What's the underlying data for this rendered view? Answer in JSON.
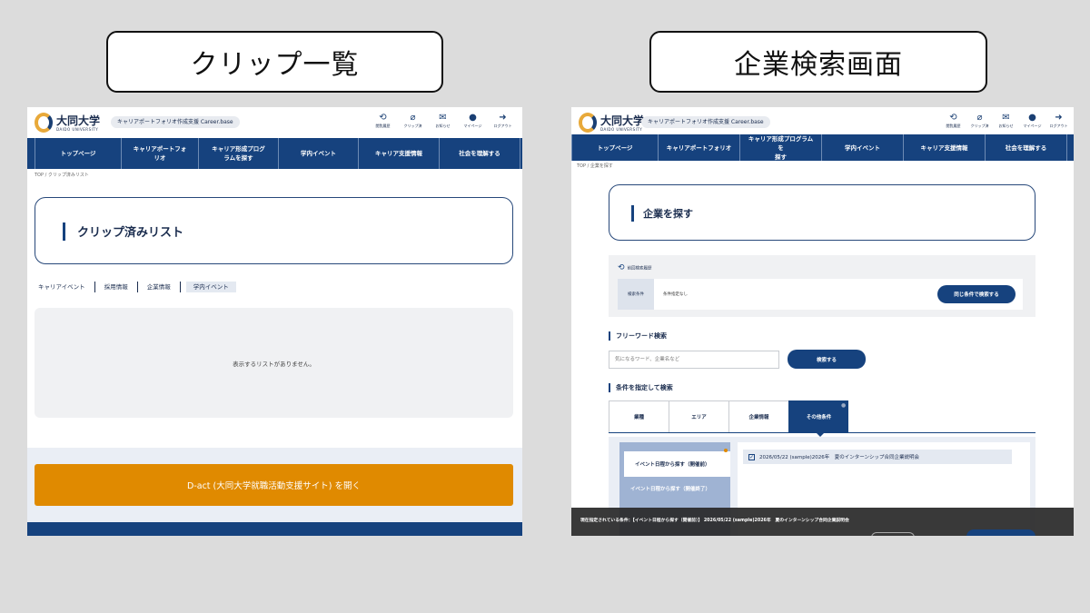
{
  "captions": {
    "left": "クリップ一覧",
    "right": "企業検索画面"
  },
  "header": {
    "logo_name": "大同大学",
    "logo_sub": "DAIDO UNIVERSITY",
    "service": "キャリアポートフォリオ作成支援 Career.base",
    "icons": [
      {
        "glyph": "⟲",
        "label": "閲覧履歴",
        "icon": "history-icon"
      },
      {
        "glyph": "⌀",
        "label": "クリップ済",
        "icon": "paperclip-icon"
      },
      {
        "glyph": "✉",
        "label": "お知らせ",
        "icon": "notice-icon"
      },
      {
        "glyph": "●",
        "label": "マイページ",
        "icon": "user-icon"
      },
      {
        "glyph": "➜",
        "label": "ログアウト",
        "icon": "logout-icon"
      }
    ]
  },
  "left": {
    "nav": [
      "トップページ",
      "キャリアポートフォ\nリオ",
      "キャリア形成プログ\nラムを探す",
      "学内イベント",
      "キャリア支援情報",
      "社会を理解する"
    ],
    "breadcrumb": "TOP / クリップ済みリスト",
    "page_title": "クリップ済みリスト",
    "tabs": [
      "キャリアイベント",
      "採用情報",
      "企業情報",
      "学内イベント"
    ],
    "empty_message": "表示するリストがありません。",
    "dact_button": "D-act (大同大学就職活動支援サイト) を開く"
  },
  "right": {
    "nav": [
      "トップページ",
      "キャリアポートフォリオ",
      "キャリア形成プログラムを\n探す",
      "学内イベント",
      "キャリア支援情報",
      "社会を理解する"
    ],
    "breadcrumb": "TOP / 企業を探す",
    "page_title": "企業を探す",
    "history_title": "前回検索履歴",
    "history_label": "検索条件",
    "history_value": "条件指定なし",
    "history_button": "同じ条件で検索する",
    "freeword_title": "フリーワード検索",
    "freeword_placeholder": "気になるワード、企業名など",
    "search_button": "検索する",
    "condition_title": "条件を指定して検索",
    "condition_tabs": [
      "業種",
      "エリア",
      "企業情報",
      "その他条件"
    ],
    "side_active": "イベント日程から探す（開催前）",
    "side_other": "イベント日程から探す（開催終了）",
    "result_item": "2026/05/22 (sample)2026年　夏のインターンシップ合同企業説明会",
    "status_text": "現在指定されている条件：【イベント日程から探す（開催前）】 2026/05/22 (sample)2026年　夏のインターンシップ合同企業説明会"
  }
}
